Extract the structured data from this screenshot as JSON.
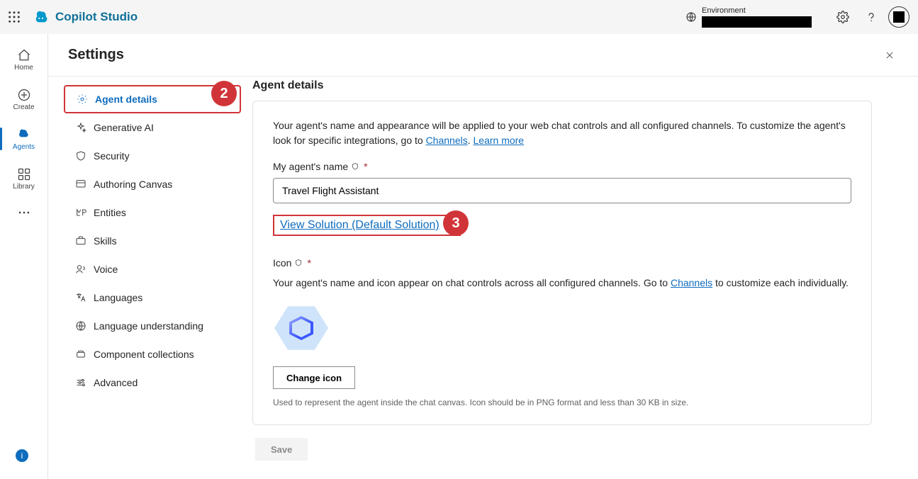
{
  "topbar": {
    "brand": "Copilot Studio",
    "env_label": "Environment"
  },
  "nav": {
    "home": "Home",
    "create": "Create",
    "agents": "Agents",
    "library": "Library"
  },
  "page": {
    "title": "Settings"
  },
  "settings_sidebar": {
    "agent_details": "Agent details",
    "generative_ai": "Generative AI",
    "security": "Security",
    "authoring_canvas": "Authoring Canvas",
    "entities": "Entities",
    "skills": "Skills",
    "voice": "Voice",
    "languages": "Languages",
    "language_understanding": "Language understanding",
    "component_collections": "Component collections",
    "advanced": "Advanced"
  },
  "details": {
    "section_title": "Agent details",
    "description_pre": "Your agent's name and appearance will be applied to your web chat controls and all configured channels. To customize the agent's look for specific integrations, go to ",
    "channels_link": "Channels",
    "learn_more_link": "Learn more",
    "name_label": "My agent's name",
    "name_value": "Travel Flight Assistant",
    "solution_link": "View Solution (Default Solution)",
    "icon_label": "Icon",
    "icon_description_pre": "Your agent's name and icon appear on chat controls across all configured channels. Go to ",
    "icon_description_post": " to customize each individually.",
    "change_icon_btn": "Change icon",
    "icon_hint": "Used to represent the agent inside the chat canvas. Icon should be in PNG format and less than 30 KB in size.",
    "save_btn": "Save"
  },
  "annotations": {
    "a2": "2",
    "a3": "3"
  }
}
